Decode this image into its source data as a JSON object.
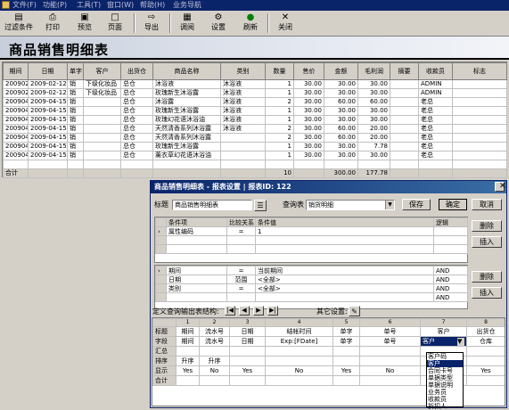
{
  "menu": [
    "文件(F)",
    "功能(P)",
    "工具(T)",
    "窗口(W)",
    "帮助(H)",
    "业务导航"
  ],
  "toolbar": {
    "filter": "过滤条件",
    "print": "打印",
    "preview": "预览",
    "page": "页面",
    "export": "导出",
    "query": "调阅",
    "settings": "设置",
    "refresh": "刷新",
    "close": "关闭"
  },
  "page_title": "商品销售明细表",
  "grid": {
    "headers": [
      "期间",
      "日期",
      "单字",
      "客户",
      "出货仓",
      "商品名称",
      "类别",
      "数量",
      "售价",
      "金额",
      "毛利润",
      "摘要",
      "收款员",
      "标志"
    ],
    "rows": [
      [
        "200902",
        "2009-02-12",
        "销",
        "下级化妆品",
        "总仓",
        "沐浴液",
        "沐浴液",
        "1",
        "30.00",
        "30.00",
        "30.00",
        "",
        "ADMIN",
        ""
      ],
      [
        "200902",
        "2009-02-12",
        "销",
        "下级化妆品",
        "总仓",
        "玫瑰新生沐浴露",
        "沐浴液",
        "1",
        "30.00",
        "30.00",
        "30.00",
        "",
        "ADMIN",
        ""
      ],
      [
        "200904",
        "2009-04-15",
        "销",
        "",
        "总仓",
        "沐浴露",
        "沐浴液",
        "2",
        "30.00",
        "60.00",
        "60.00",
        "",
        "老总",
        ""
      ],
      [
        "200904",
        "2009-04-15",
        "销",
        "",
        "总仓",
        "玫瑰新生沐浴露",
        "沐浴液",
        "1",
        "30.00",
        "30.00",
        "30.00",
        "",
        "老总",
        ""
      ],
      [
        "200904",
        "2009-04-15",
        "销",
        "",
        "总仓",
        "玫瑰幻花语沐浴油",
        "沐浴液",
        "1",
        "30.00",
        "30.00",
        "30.00",
        "",
        "老总",
        ""
      ],
      [
        "200904",
        "2009-04-15",
        "销",
        "",
        "总仓",
        "天然清香系列沐浴露",
        "沐浴液",
        "2",
        "30.00",
        "60.00",
        "20.00",
        "",
        "老总",
        ""
      ],
      [
        "200904",
        "2009-04-15",
        "销",
        "",
        "总仓",
        "天然清香系列沐浴露",
        "",
        "2",
        "30.00",
        "60.00",
        "20.00",
        "",
        "老总",
        ""
      ],
      [
        "200904",
        "2009-04-15",
        "销",
        "",
        "总仓",
        "玫瑰新生沐浴露",
        "",
        "1",
        "30.00",
        "30.00",
        "7.78",
        "",
        "老总",
        ""
      ],
      [
        "200904",
        "2009-04-15",
        "销",
        "",
        "总仓",
        "薰衣草幻花语沐浴油",
        "",
        "1",
        "30.00",
        "30.00",
        "30.00",
        "",
        "老总",
        ""
      ]
    ],
    "total": {
      "label": "合计",
      "qty": "10",
      "amount": "300.00",
      "profit": "177.78"
    }
  },
  "dialog": {
    "caption": "商品销售明细表 - 报表设置 | 报表ID: 122",
    "title_label": "标题",
    "title_value": "商品销售明细表",
    "query_label": "查询表",
    "query_value": "销货明细",
    "save": "保存",
    "ok": "确定",
    "cancel": "取消",
    "cond_headers": [
      "条件项",
      "比较关系",
      "条件值",
      "逻辑"
    ],
    "cond_rows": [
      [
        "属性编码",
        "=",
        "1",
        ""
      ]
    ],
    "filter_rows": [
      [
        "期间",
        "=",
        "当前期间",
        "AND"
      ],
      [
        "日期",
        "范围",
        "<全部>",
        "AND"
      ],
      [
        "类别",
        "=",
        "<全部>",
        "AND"
      ],
      [
        "",
        "",
        "",
        "AND"
      ]
    ],
    "delete1": "删除",
    "insert1": "插入",
    "delete2": "删除",
    "insert2": "插入",
    "struct_label": "定义查询输出表结构:",
    "other_label": "其它设置:",
    "layout": {
      "col_numbers": [
        "1",
        "2",
        "3",
        "4",
        "5",
        "6",
        "7",
        "8"
      ],
      "row_labels": [
        "标题",
        "字段",
        "汇总",
        "排序",
        "显示",
        "合计"
      ],
      "titles": [
        "期间",
        "流水号",
        "日期",
        "结帐时间",
        "单字",
        "单号",
        "客户",
        "出货仓"
      ],
      "fields": [
        "期间",
        "流水号",
        "日期",
        "Exp:[FDate]",
        "单字",
        "单号",
        "客户",
        "仓库"
      ],
      "sort": [
        "升序",
        "升序",
        "",
        "",
        "",
        "",
        "",
        ""
      ],
      "show": [
        "Yes",
        "No",
        "Yes",
        "No",
        "Yes",
        "No",
        "",
        "Yes"
      ]
    },
    "dropdown": [
      "客户",
      "客户码",
      "客户",
      "合同卡号",
      "单据类型",
      "单据说明",
      "业务员",
      "收款员",
      "折扣人"
    ]
  }
}
